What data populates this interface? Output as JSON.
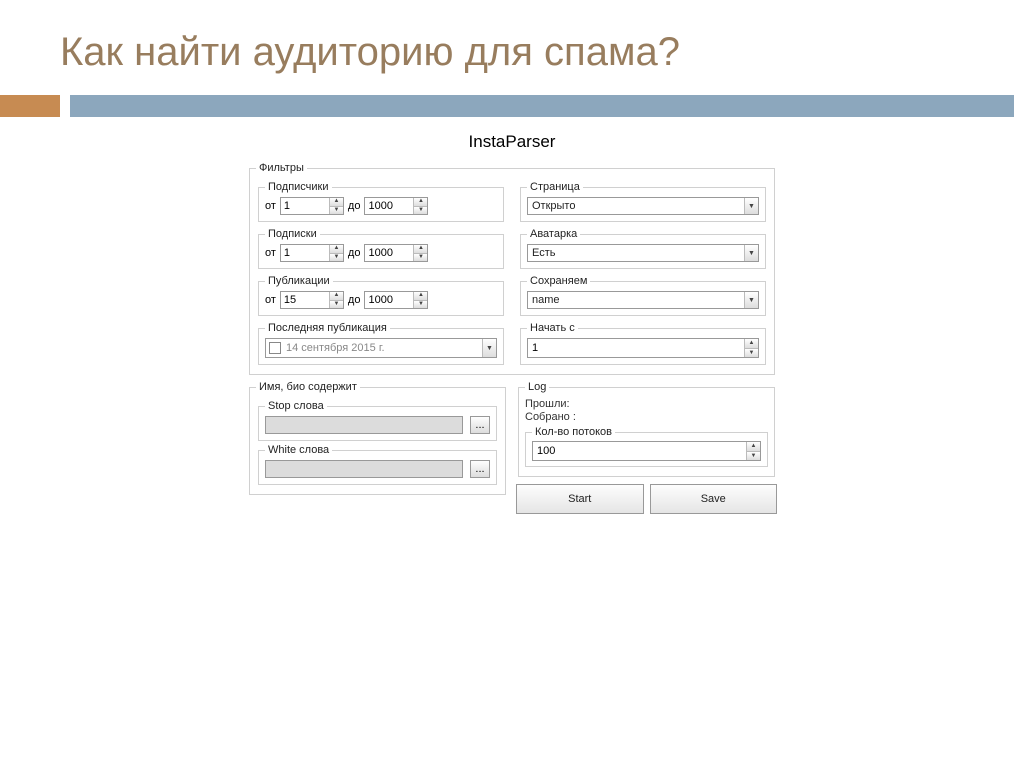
{
  "slide": {
    "title": "Как найти аудиторию для спама?"
  },
  "app": {
    "title": "InstaParser"
  },
  "filters": {
    "legend": "Фильтры",
    "subscribers": {
      "legend": "Подписчики",
      "from_label": "от",
      "from_val": "1",
      "to_label": "до",
      "to_val": "1000"
    },
    "subscriptions": {
      "legend": "Подписки",
      "from_label": "от",
      "from_val": "1",
      "to_label": "до",
      "to_val": "1000"
    },
    "posts": {
      "legend": "Публикации",
      "from_label": "от",
      "from_val": "15",
      "to_label": "до",
      "to_val": "1000"
    },
    "last_post": {
      "legend": "Последняя публикация",
      "date": "14 сентября 2015 г."
    },
    "page": {
      "legend": "Страница",
      "value": "Открыто"
    },
    "avatar": {
      "legend": "Аватарка",
      "value": "Есть"
    },
    "save_as": {
      "legend": "Сохраняем",
      "value": "name"
    },
    "start_from": {
      "legend": "Начать с",
      "value": "1"
    }
  },
  "bio": {
    "legend": "Имя, био содержит",
    "stop": {
      "legend": "Stop слова"
    },
    "white": {
      "legend": "White слова"
    },
    "dot": "..."
  },
  "log": {
    "legend": "Log",
    "passed": "Прошли:",
    "collected": "Собрано :",
    "threads": {
      "legend": "Кол-во потоков",
      "value": "100"
    }
  },
  "buttons": {
    "start": "Start",
    "save": "Save"
  }
}
